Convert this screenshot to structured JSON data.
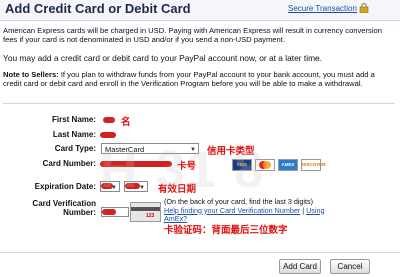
{
  "header": {
    "title": "Add Credit Card or Debit Card",
    "secure_link": "Secure Transaction",
    "lock_icon": "lock-icon"
  },
  "intro": {
    "p1": "American Express cards will be charged in USD. Paying with American Express will result in currency conversion fees if your card is not denominated in USD and/or if you send a non-USD payment.",
    "p2": "You may add a credit card or debit card to your PayPal account now, or at a later time.",
    "p3_bold": "Note to Sellers:",
    "p3_rest": " If you plan to withdraw funds from your PayPal account to your bank account, you must add a credit card or debit card and enroll in the Verification Program before you will be able to make a withdrawal."
  },
  "form": {
    "first_name_label": "First Name:",
    "last_name_label": "Last Name:",
    "card_type_label": "Card Type:",
    "card_type_value": "MasterCard",
    "card_number_label": "Card Number:",
    "expiration_label": "Expiration Date:",
    "verification_label": "Card Verification\nNumber:"
  },
  "annotations": {
    "name": "名",
    "card_type": "信用卡类型",
    "card_number": "卡号",
    "expiration": "有效日期",
    "verification": "卡验证码：背面最后三位数字"
  },
  "card_logos": [
    "VISA",
    "MC",
    "AMEX",
    "DISCOVER"
  ],
  "cvv_digits": "123",
  "hint": {
    "line1": "(On the back of your card, find the last 3 digits)",
    "link1": "Help finding your Card Verification Number",
    "sep": " | ",
    "link2": "Using",
    "link3": "AmEx?"
  },
  "buttons": {
    "add": "Add Card",
    "cancel": "Cancel"
  },
  "watermark": "H 31 8",
  "colors": {
    "link": "#1d4ea8",
    "annotation_red": "#e01010"
  }
}
